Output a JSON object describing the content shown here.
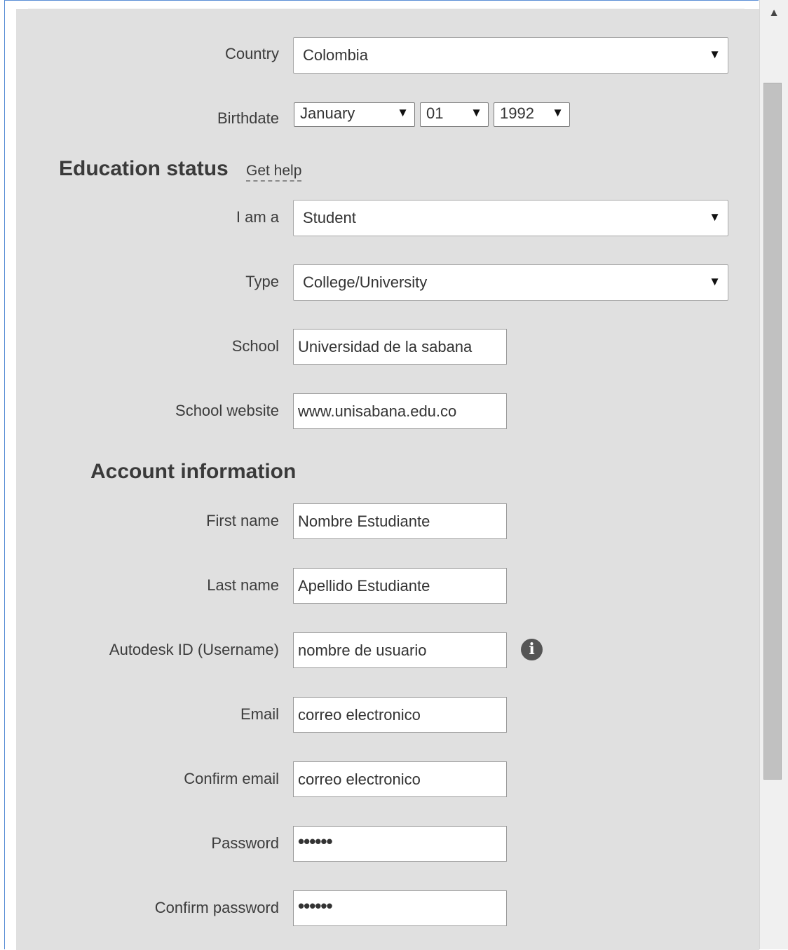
{
  "location": {
    "country_label": "Country",
    "country_value": "Colombia",
    "birthdate_label": "Birthdate",
    "birth_month": "January",
    "birth_day": "01",
    "birth_year": "1992"
  },
  "education": {
    "heading": "Education status",
    "help_link": "Get help",
    "iam_label": "I am a",
    "iam_value": "Student",
    "type_label": "Type",
    "type_value": "College/University",
    "school_label": "School",
    "school_value": "Universidad de la sabana",
    "website_label": "School website",
    "website_value": "www.unisabana.edu.co"
  },
  "account": {
    "heading": "Account information",
    "first_name_label": "First name",
    "first_name_value": "Nombre Estudiante",
    "last_name_label": "Last name",
    "last_name_value": "Apellido Estudiante",
    "username_label": "Autodesk ID (Username)",
    "username_value": "nombre de usuario",
    "email_label": "Email",
    "email_value": "correo electronico",
    "confirm_email_label": "Confirm email",
    "confirm_email_value": "correo electronico",
    "password_label": "Password",
    "password_mask": "••••••",
    "confirm_password_label": "Confirm password",
    "confirm_password_mask": "••••••"
  },
  "icons": {
    "dropdown_arrow": "▼",
    "info": "i",
    "scroll_up": "▲"
  }
}
